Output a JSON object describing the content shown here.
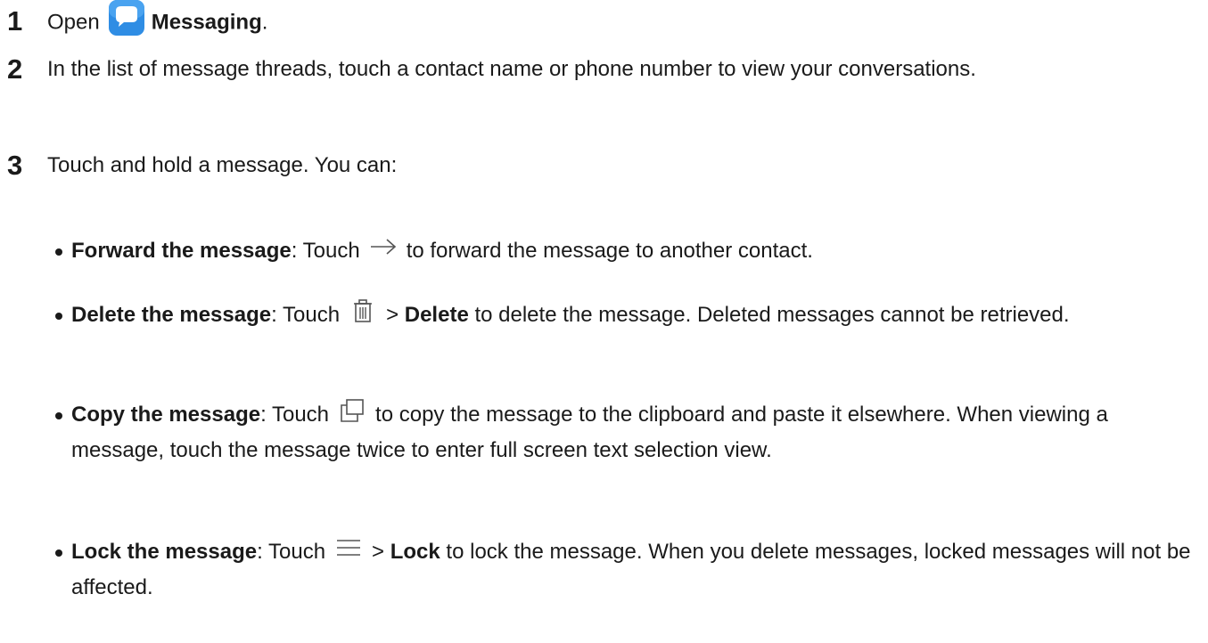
{
  "steps": [
    {
      "number": "1",
      "text_before": "Open",
      "icon": "messaging-app-icon",
      "bold": "Messaging",
      "text_after": "."
    },
    {
      "number": "2",
      "text": "In the list of message threads, touch a contact name or phone number to view your conversations."
    },
    {
      "number": "3",
      "text": "Touch and hold a message. You can:"
    }
  ],
  "bullets": [
    {
      "title": "Forward the message",
      "sep": ": Touch",
      "icon": "arrow-right-icon",
      "text": "to forward the message to another contact."
    },
    {
      "title": "Delete the message",
      "sep": ": Touch",
      "icon": "trash-icon",
      "mid": ">",
      "bold2": "Delete",
      "text": "to delete the message. Deleted messages cannot be retrieved."
    },
    {
      "title": "Copy the message",
      "sep": ": Touch",
      "icon": "copy-icon",
      "text": "to copy the message to the clipboard and paste it elsewhere. When viewing a message, touch the message twice to enter full screen text selection view."
    },
    {
      "title": "Lock the message",
      "sep": ": Touch",
      "icon": "menu-icon",
      "mid": ">",
      "bold2": "Lock",
      "text": "to lock the message. When you delete messages, locked messages will not be affected."
    }
  ],
  "colors": {
    "text": "#1a1a1a",
    "app_icon_bg": "#2f8de4"
  }
}
